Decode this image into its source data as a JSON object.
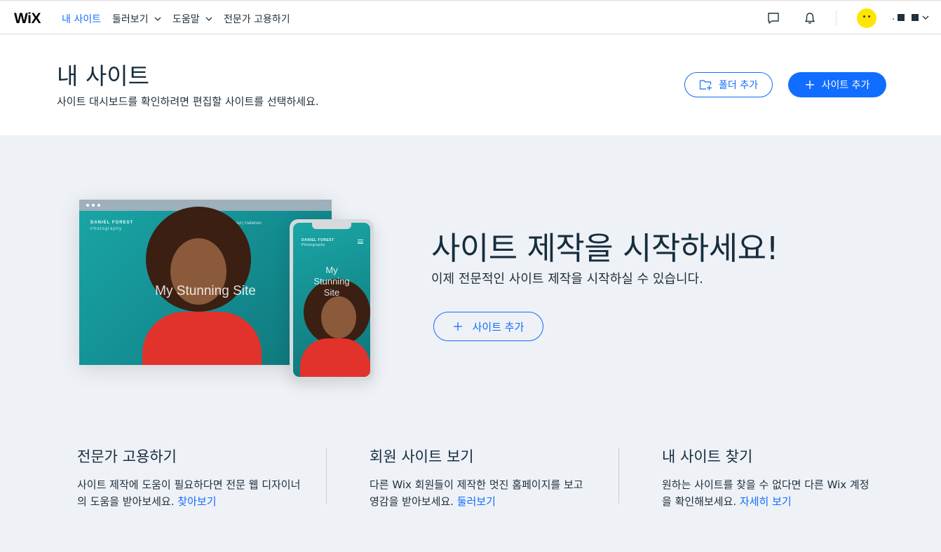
{
  "topbar": {
    "logo": "WiX",
    "nav": [
      {
        "label": "내 사이트",
        "active": true,
        "dropdown": false
      },
      {
        "label": "둘러보기",
        "active": false,
        "dropdown": true
      },
      {
        "label": "도움말",
        "active": false,
        "dropdown": true
      },
      {
        "label": "전문가 고용하기",
        "active": false,
        "dropdown": false
      }
    ],
    "icons": [
      "chat-icon",
      "bell-icon",
      "chevron-down-icon"
    ],
    "account_label": "."
  },
  "header": {
    "title": "내 사이트",
    "subtitle": "사이트 대시보드를 확인하려면 편집할 사이트를 선택하세요.",
    "add_folder_label": "폴더 추가",
    "add_site_label": "사이트 추가"
  },
  "hero": {
    "title": "사이트 제작을 시작하세요!",
    "subtitle": "이제 전문적인 사이트 제작을 시작하실 수 있습니다.",
    "add_site_label": "사이트 추가",
    "preview": {
      "brand": "DANIEL FOREST",
      "brand_sub": "Photography",
      "menu": "Home  |  About  |  Galleries",
      "site_text": "My Stunning Site",
      "phone_text_lines": [
        "My",
        "Stunning",
        "Site"
      ]
    }
  },
  "info_cards": [
    {
      "title": "전문가 고용하기",
      "text": "사이트 제작에 도움이 필요하다면 전문 웹 디자이너의 도움을 받아보세요.",
      "link": "찾아보기"
    },
    {
      "title": "회원 사이트 보기",
      "text": "다른 Wix 회원들이 제작한 멋진 홈페이지를 보고 영감을 받아보세요.",
      "link": "둘러보기"
    },
    {
      "title": "내 사이트 찾기",
      "text": "원하는 사이트를 찾을 수 없다면 다른 Wix 계정을 확인해보세요.",
      "link": "자세히 보기"
    }
  ],
  "colors": {
    "accent": "#116dff",
    "background": "#eef1f6",
    "avatar": "#ffe600"
  }
}
